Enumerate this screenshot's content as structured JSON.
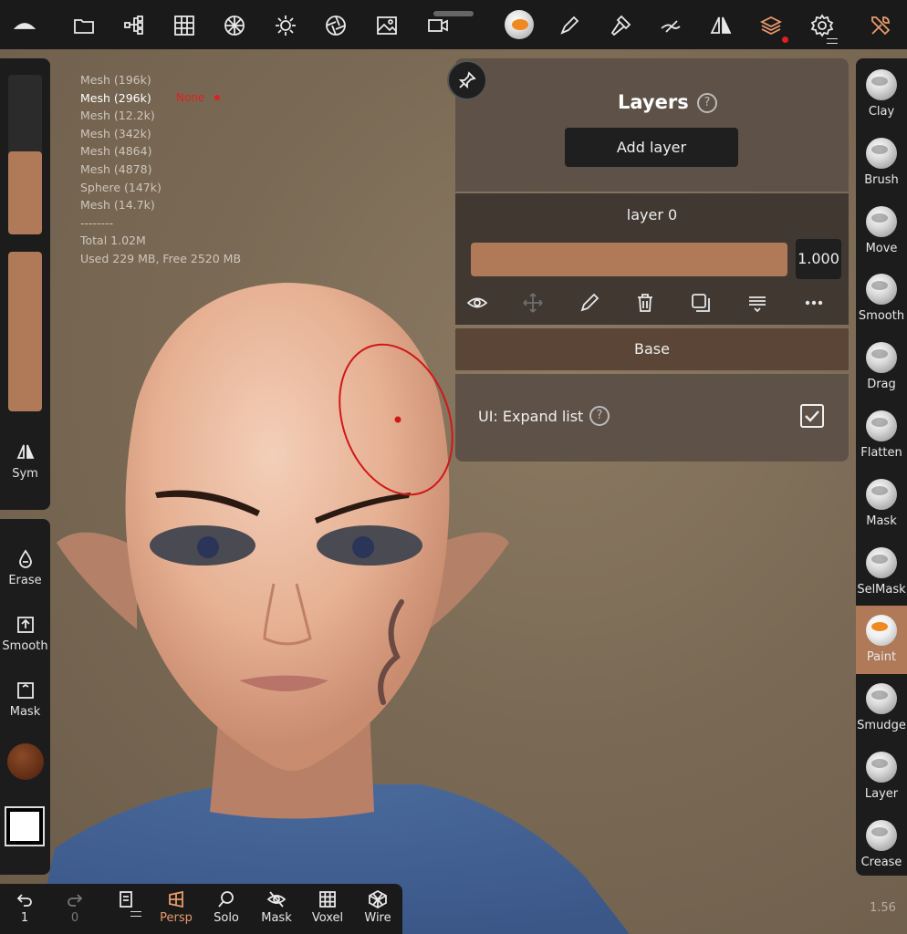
{
  "topbar": {
    "icons": [
      "nomad-logo-icon",
      "folder-icon",
      "scene-tree-icon",
      "grid-icon",
      "topology-icon",
      "light-icon",
      "camera-settings-icon",
      "image-icon",
      "video-icon",
      "material-ball-icon",
      "pen-icon",
      "hammer-icon",
      "stroke-icon",
      "symmetry-icon",
      "layers-icon",
      "settings-icon",
      "tools-icon"
    ]
  },
  "stats": {
    "meshes": [
      "Mesh (196k)",
      "Mesh (296k)",
      "Mesh (12.2k)",
      "Mesh (342k)",
      "Mesh (4864)",
      "Mesh (4878)",
      "Sphere (147k)",
      "Mesh (14.7k)"
    ],
    "selected_index": 1,
    "none_label": "None",
    "separator": "--------",
    "total": "Total 1.02M",
    "memory": "Used 229 MB,  Free 2520 MB"
  },
  "left_top": {
    "slider1_level": 0.52,
    "slider2_level": 1.0,
    "sym_label": "Sym"
  },
  "left_bottom": {
    "erase_label": "Erase",
    "smooth_label": "Smooth",
    "mask_label": "Mask"
  },
  "colors": {
    "accent": "#b07a58",
    "brush_color": "#6b3418",
    "secondary_color": "#ffffff",
    "cursor_red": "#e02020"
  },
  "tools": [
    {
      "label": "Clay",
      "active": false
    },
    {
      "label": "Brush",
      "active": false
    },
    {
      "label": "Move",
      "active": false
    },
    {
      "label": "Smooth",
      "active": false
    },
    {
      "label": "Drag",
      "active": false
    },
    {
      "label": "Flatten",
      "active": false
    },
    {
      "label": "Mask",
      "active": false
    },
    {
      "label": "SelMask",
      "active": false
    },
    {
      "label": "Paint",
      "active": true
    },
    {
      "label": "Smudge",
      "active": false
    },
    {
      "label": "Layer",
      "active": false
    },
    {
      "label": "Crease",
      "active": false
    }
  ],
  "bottombar": {
    "undo_count": "1",
    "redo_count": "0",
    "persp": "Persp",
    "solo": "Solo",
    "mask": "Mask",
    "voxel": "Voxel",
    "wire": "Wire"
  },
  "version": "1.56",
  "layers_panel": {
    "title": "Layers",
    "help": "?",
    "add_layer": "Add layer",
    "layer_name": "layer 0",
    "layer_value": "1.000",
    "base": "Base",
    "expand_label": "UI: Expand list",
    "expand_help": "?",
    "expand_checked": true
  }
}
